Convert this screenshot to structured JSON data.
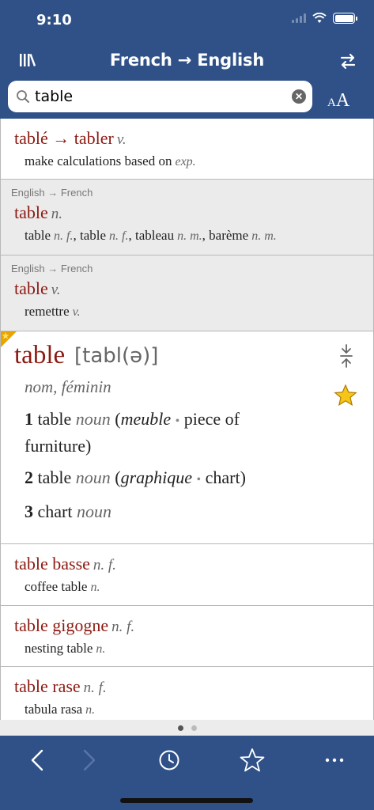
{
  "status": {
    "time": "9:10"
  },
  "nav": {
    "title": "French → English"
  },
  "search": {
    "value": "table",
    "placeholder": ""
  },
  "font_size_button": {
    "small": "A",
    "big": "A"
  },
  "results": [
    {
      "label": "",
      "headword": "tablé → tabler",
      "pos": "v.",
      "translation": "make calculations based on",
      "translation_pos": "exp."
    },
    {
      "label": "English → French",
      "headword": "table",
      "pos": "n.",
      "translations": [
        {
          "word": "table",
          "pos": "n. f."
        },
        {
          "word": "table",
          "pos": "n. f."
        },
        {
          "word": "tableau",
          "pos": "n. m."
        },
        {
          "word": "barème",
          "pos": "n. m."
        }
      ]
    },
    {
      "label": "English → French",
      "headword": "table",
      "pos": "v.",
      "translation": "remettre",
      "translation_pos": "v."
    }
  ],
  "entry": {
    "headword": "table",
    "pronunciation": "[tabl(ə)]",
    "gender": "nom, féminin",
    "senses": [
      {
        "num": "1",
        "word": "table",
        "pos": "noun",
        "domain": "meuble",
        "gloss": "piece of",
        "gloss2": "furniture)"
      },
      {
        "num": "2",
        "word": "table",
        "pos": "noun",
        "domain": "graphique",
        "gloss": "chart)"
      },
      {
        "num": "3",
        "word": "chart",
        "pos": "noun"
      }
    ]
  },
  "compounds": [
    {
      "headword": "table basse",
      "pos": "n. f.",
      "translation": "coffee table",
      "translation_pos": "n."
    },
    {
      "headword": "table gigogne",
      "pos": "n. f.",
      "translation": "nesting table",
      "translation_pos": "n."
    },
    {
      "headword": "table rase",
      "pos": "n. f.",
      "translation": "tabula rasa",
      "translation_pos": "n."
    }
  ],
  "colors": {
    "header": "#2f5188",
    "headword": "#8b1a12",
    "star": "#f5c518"
  },
  "icons": {
    "library": "library-icon",
    "swap": "swap-icon",
    "search": "search-icon",
    "clear": "clear-icon",
    "collapse": "collapse-icon",
    "favorite": "star-icon",
    "back": "back-chevron-icon",
    "forward": "forward-chevron-icon",
    "history": "clock-icon",
    "favorites": "star-outline-icon",
    "more": "more-icon"
  }
}
